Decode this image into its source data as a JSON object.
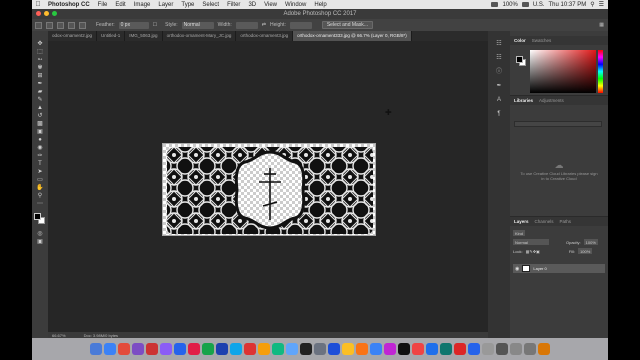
{
  "menubar": {
    "items": [
      "Photoshop CC",
      "File",
      "Edit",
      "Image",
      "Layer",
      "Type",
      "Select",
      "Filter",
      "3D",
      "View",
      "Window",
      "Help"
    ],
    "battery": "100%",
    "locale": "U.S.",
    "clock": "Thu 10:37 PM"
  },
  "window": {
    "title": "Adobe Photoshop CC 2017"
  },
  "options": {
    "feather_label": "Feather:",
    "feather_value": "0 px",
    "style_label": "Style:",
    "style_value": "Normal",
    "width_label": "Width:",
    "height_label": "Height:",
    "select_mask_label": "Select and Mask..."
  },
  "tabs": [
    "odox-ornament2.jpg",
    "Untitled-1",
    "IMG_5063.jpg",
    "orthodox-ornament-Mary_JC.jpg",
    "orthodox-ornament3.jpg",
    "orthodox-ornament333.jpg @ 66.7% (Layer 0, RGB/8*)"
  ],
  "status": {
    "zoom": "66.67%",
    "doc": "Doc: 3.98M/0 bytes"
  },
  "panels": {
    "color_tabs": [
      "Color",
      "Swatches"
    ],
    "library_tabs": [
      "Libraries",
      "Adjustments"
    ],
    "library_message": "To use Creative Cloud Libraries please sign in to Creative Cloud",
    "layers_tabs": [
      "Layers",
      "Channels",
      "Paths"
    ],
    "kind_label": "Kind",
    "blend_mode": "Normal",
    "opacity_label": "Opacity:",
    "opacity_value": "100%",
    "lock_label": "Lock:",
    "fill_label": "Fill:",
    "fill_value": "100%",
    "layer_name": "Layer 0"
  },
  "colors": {
    "dock_icons": [
      "#4a7bd8",
      "#3b82f6",
      "#e34b3b",
      "#7c4dc4",
      "#c33",
      "#8b5cf6",
      "#2563eb",
      "#e11d48",
      "#16a34a",
      "#1e40af",
      "#0ea5e9",
      "#d33",
      "#f59e0b",
      "#10b981",
      "#60a5fa",
      "#222",
      "#6b7280",
      "#1d4ed8",
      "#fbbf24",
      "#f97316",
      "#3b82f6",
      "#c026d3",
      "#111",
      "#ef4444",
      "#1f6feb",
      "#0f766e",
      "#dc2626",
      "#2563eb",
      "#999",
      "#555",
      "#888",
      "#777",
      "#d97706"
    ]
  }
}
